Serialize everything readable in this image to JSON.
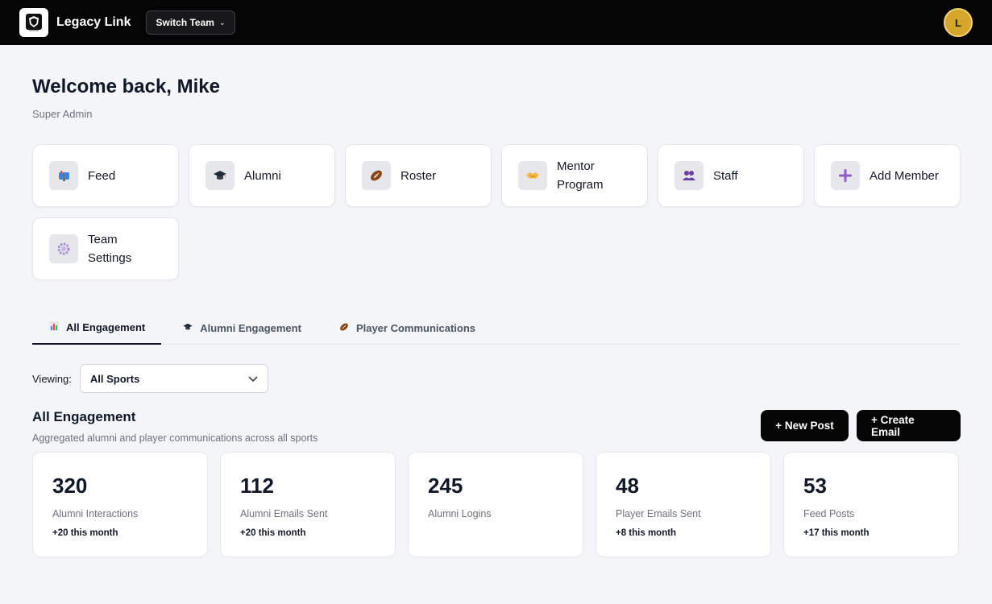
{
  "topbar": {
    "brand": "Legacy Link",
    "switch_team_label": "Switch Team",
    "avatar_initial": "L",
    "avatar_color": "#d4a72c"
  },
  "welcome": {
    "title": "Welcome back, Mike",
    "role": "Super Admin"
  },
  "tiles": [
    {
      "label": "Feed",
      "icon": "mailbox-icon"
    },
    {
      "label": "Alumni",
      "icon": "graduation-cap-icon"
    },
    {
      "label": "Roster",
      "icon": "football-icon"
    },
    {
      "label": "Mentor Program",
      "icon": "handshake-icon"
    },
    {
      "label": "Staff",
      "icon": "people-icon"
    },
    {
      "label": "Add Member",
      "icon": "plus-icon"
    },
    {
      "label": "Team Settings",
      "icon": "gear-icon"
    }
  ],
  "tabs": [
    {
      "label": "All Engagement",
      "icon": "bar-chart-icon",
      "active": true
    },
    {
      "label": "Alumni Engagement",
      "icon": "graduation-cap-icon",
      "active": false
    },
    {
      "label": "Player Communications",
      "icon": "football-icon",
      "active": false
    }
  ],
  "viewing": {
    "label": "Viewing:",
    "selected": "All Sports"
  },
  "section": {
    "title": "All Engagement",
    "subtitle": "Aggregated alumni and player communications across all sports",
    "new_post_label": "+ New Post",
    "create_email_label": "+ Create Email"
  },
  "stats": [
    {
      "value": "320",
      "label": "Alumni Interactions",
      "delta": "+20 this month"
    },
    {
      "value": "112",
      "label": "Alumni Emails Sent",
      "delta": "+20 this month"
    },
    {
      "value": "245",
      "label": "Alumni Logins",
      "delta": ""
    },
    {
      "value": "48",
      "label": "Player Emails Sent",
      "delta": "+8 this month"
    },
    {
      "value": "53",
      "label": "Feed Posts",
      "delta": "+17 this month"
    }
  ]
}
